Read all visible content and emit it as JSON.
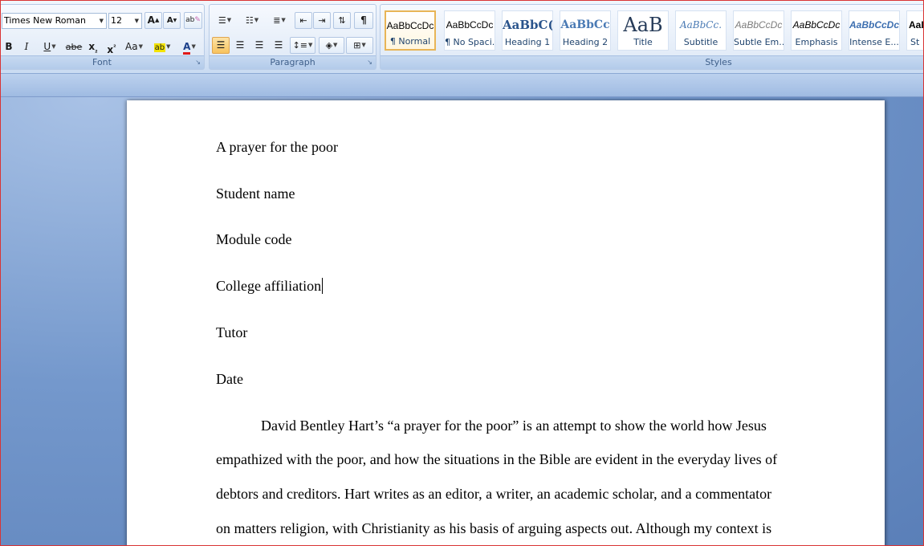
{
  "ribbon": {
    "font": {
      "group_label": "Font",
      "font_name": "Times New Roman",
      "font_size": "12",
      "grow_label": "A",
      "shrink_label": "A",
      "clear_label": "ab",
      "bold_label": "B",
      "italic_label": "I",
      "underline_label": "U",
      "strike_label": "abe",
      "subscript_label": "x",
      "superscript_label": "x",
      "case_label": "Aa",
      "highlight_label": "ab",
      "font_color_label": "A",
      "highlight_color": "#f3e300",
      "font_color": "#e01a1a"
    },
    "paragraph": {
      "group_label": "Paragraph",
      "show_marks_label": "¶"
    },
    "styles": {
      "group_label": "Styles",
      "items": [
        {
          "preview": "AaBbCcDc",
          "name": "¶ Normal"
        },
        {
          "preview": "AaBbCcDc",
          "name": "¶ No Spaci..."
        },
        {
          "preview": "AaBbC(",
          "name": "Heading 1"
        },
        {
          "preview": "AaBbCc",
          "name": "Heading 2"
        },
        {
          "preview": "AaB",
          "name": "Title"
        },
        {
          "preview": "AaBbCc.",
          "name": "Subtitle"
        },
        {
          "preview": "AaBbCcDc",
          "name": "Subtle Em..."
        },
        {
          "preview": "AaBbCcDc",
          "name": "Emphasis"
        },
        {
          "preview": "AaBbCcDc",
          "name": "Intense E..."
        },
        {
          "preview": "AaI",
          "name": "St"
        }
      ]
    }
  },
  "document": {
    "title": "A prayer for the poor",
    "student": "Student name",
    "module": "Module code",
    "college": "College affiliation",
    "tutor": "Tutor",
    "date": "Date",
    "body_lines": [
      "David Bentley Hart’s “a prayer for the poor” is an attempt to show the world how Jesus",
      "empathized with the poor, and how the situations in the Bible are evident in the everyday lives of",
      "debtors and creditors. Hart writes as an editor, a writer, an academic scholar, and a commentator",
      "on matters religion, with Christianity as his basis of arguing aspects out. Although my context is"
    ]
  }
}
